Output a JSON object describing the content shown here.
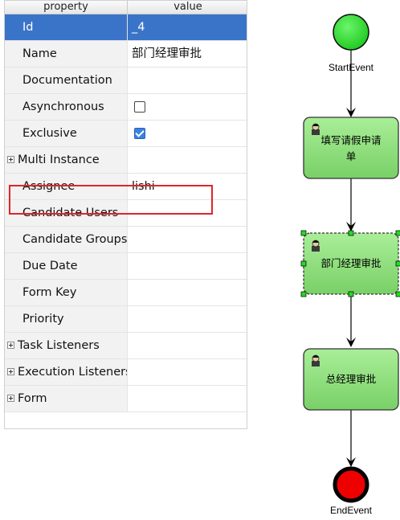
{
  "grid": {
    "header": {
      "property": "property",
      "value": "value"
    },
    "rows": [
      {
        "label": "Id",
        "value": "_4"
      },
      {
        "label": "Name",
        "value": "部门经理审批"
      },
      {
        "label": "Documentation",
        "value": ""
      },
      {
        "label": "Asynchronous",
        "checked": false
      },
      {
        "label": "Exclusive",
        "checked": true
      },
      {
        "label": "Multi Instance"
      },
      {
        "label": "Assignee",
        "value": "lishi"
      },
      {
        "label": "Candidate Users",
        "value": ""
      },
      {
        "label": "Candidate Groups",
        "value": ""
      },
      {
        "label": "Due Date",
        "value": ""
      },
      {
        "label": "Form Key",
        "value": ""
      },
      {
        "label": "Priority",
        "value": ""
      },
      {
        "label": "Task Listeners"
      },
      {
        "label": "Execution Listeners"
      },
      {
        "label": "Form"
      }
    ],
    "selected_color": "#3a74c8",
    "highlight_color": "#e0242c"
  },
  "diagram": {
    "start_label": "StartEvent",
    "end_label": "EndEvent",
    "task1": {
      "line1": "填写请假申请",
      "line2": "单"
    },
    "task2": {
      "line1": "部门经理审批"
    },
    "task3": {
      "line1": "总经理审批"
    },
    "start_color": "#22dd22",
    "end_color": "#ee0000",
    "task_color": "#8fe07a"
  }
}
